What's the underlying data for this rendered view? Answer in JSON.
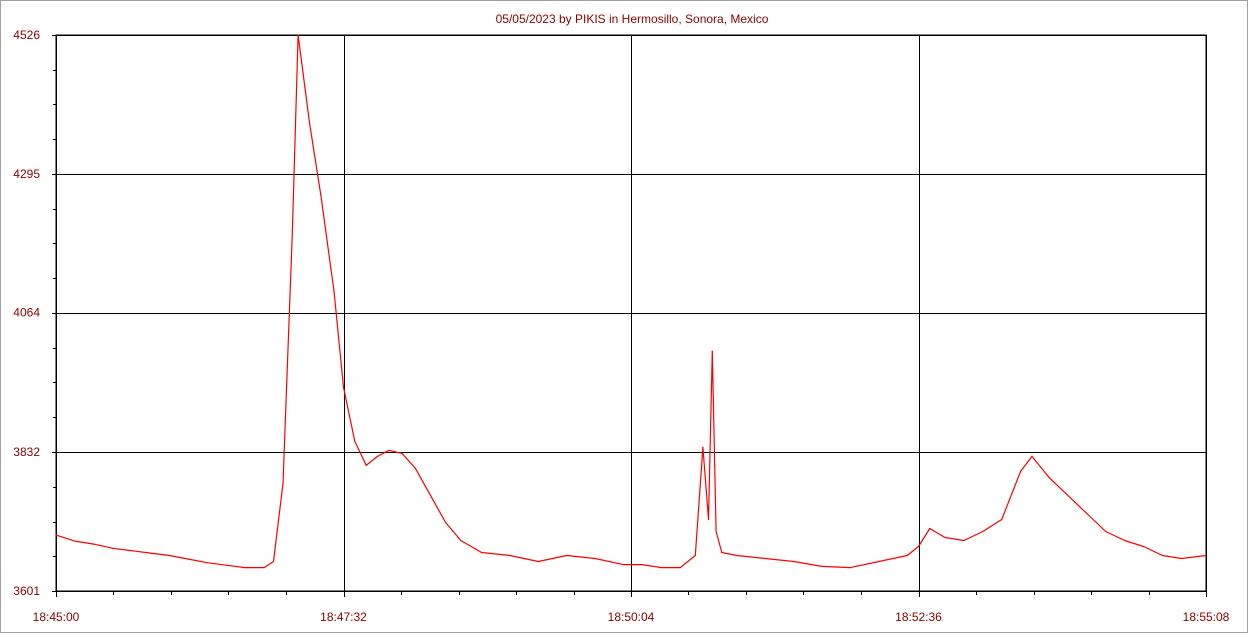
{
  "chart_data": {
    "type": "line",
    "title": "05/05/2023  by  PIKIS  in  Hermosillo, Sonora, Mexico",
    "xlabel": "",
    "ylabel": "",
    "x_ticks": [
      "18:45:00",
      "18:47:32",
      "18:50:04",
      "18:52:36",
      "18:55:08"
    ],
    "y_ticks": [
      3601,
      3832,
      4064,
      4295,
      4526
    ],
    "xlim": [
      "18:45:00",
      "18:55:08"
    ],
    "ylim": [
      3601,
      4526
    ],
    "grid": true,
    "series": [
      {
        "name": "",
        "color": "#ff0000",
        "points": [
          [
            "18:45:00",
            3694
          ],
          [
            "18:45:10",
            3684
          ],
          [
            "18:45:20",
            3679
          ],
          [
            "18:45:30",
            3672
          ],
          [
            "18:45:40",
            3668
          ],
          [
            "18:45:50",
            3664
          ],
          [
            "18:46:00",
            3660
          ],
          [
            "18:46:10",
            3654
          ],
          [
            "18:46:20",
            3648
          ],
          [
            "18:46:30",
            3644
          ],
          [
            "18:46:40",
            3640
          ],
          [
            "18:46:50",
            3640
          ],
          [
            "18:46:55",
            3650
          ],
          [
            "18:47:00",
            3780
          ],
          [
            "18:47:05",
            4200
          ],
          [
            "18:47:08",
            4526
          ],
          [
            "18:47:14",
            4380
          ],
          [
            "18:47:20",
            4260
          ],
          [
            "18:47:27",
            4100
          ],
          [
            "18:47:32",
            3940
          ],
          [
            "18:47:38",
            3850
          ],
          [
            "18:47:44",
            3810
          ],
          [
            "18:47:50",
            3825
          ],
          [
            "18:47:56",
            3835
          ],
          [
            "18:48:03",
            3830
          ],
          [
            "18:48:10",
            3805
          ],
          [
            "18:48:18",
            3760
          ],
          [
            "18:48:26",
            3715
          ],
          [
            "18:48:34",
            3685
          ],
          [
            "18:48:45",
            3665
          ],
          [
            "18:49:00",
            3660
          ],
          [
            "18:49:15",
            3650
          ],
          [
            "18:49:30",
            3660
          ],
          [
            "18:49:45",
            3655
          ],
          [
            "18:50:00",
            3645
          ],
          [
            "18:50:10",
            3645
          ],
          [
            "18:50:20",
            3640
          ],
          [
            "18:50:30",
            3640
          ],
          [
            "18:50:38",
            3660
          ],
          [
            "18:50:42",
            3840
          ],
          [
            "18:50:45",
            3720
          ],
          [
            "18:50:47",
            4000
          ],
          [
            "18:50:49",
            3700
          ],
          [
            "18:50:52",
            3665
          ],
          [
            "18:51:00",
            3660
          ],
          [
            "18:51:15",
            3655
          ],
          [
            "18:51:30",
            3650
          ],
          [
            "18:51:45",
            3642
          ],
          [
            "18:52:00",
            3640
          ],
          [
            "18:52:15",
            3650
          ],
          [
            "18:52:30",
            3660
          ],
          [
            "18:52:36",
            3675
          ],
          [
            "18:52:42",
            3705
          ],
          [
            "18:52:50",
            3690
          ],
          [
            "18:53:00",
            3685
          ],
          [
            "18:53:10",
            3700
          ],
          [
            "18:53:20",
            3720
          ],
          [
            "18:53:30",
            3800
          ],
          [
            "18:53:36",
            3825
          ],
          [
            "18:53:45",
            3790
          ],
          [
            "18:53:55",
            3760
          ],
          [
            "18:54:05",
            3730
          ],
          [
            "18:54:15",
            3700
          ],
          [
            "18:54:25",
            3685
          ],
          [
            "18:54:35",
            3675
          ],
          [
            "18:54:45",
            3660
          ],
          [
            "18:54:55",
            3655
          ],
          [
            "18:55:08",
            3660
          ]
        ]
      }
    ]
  }
}
